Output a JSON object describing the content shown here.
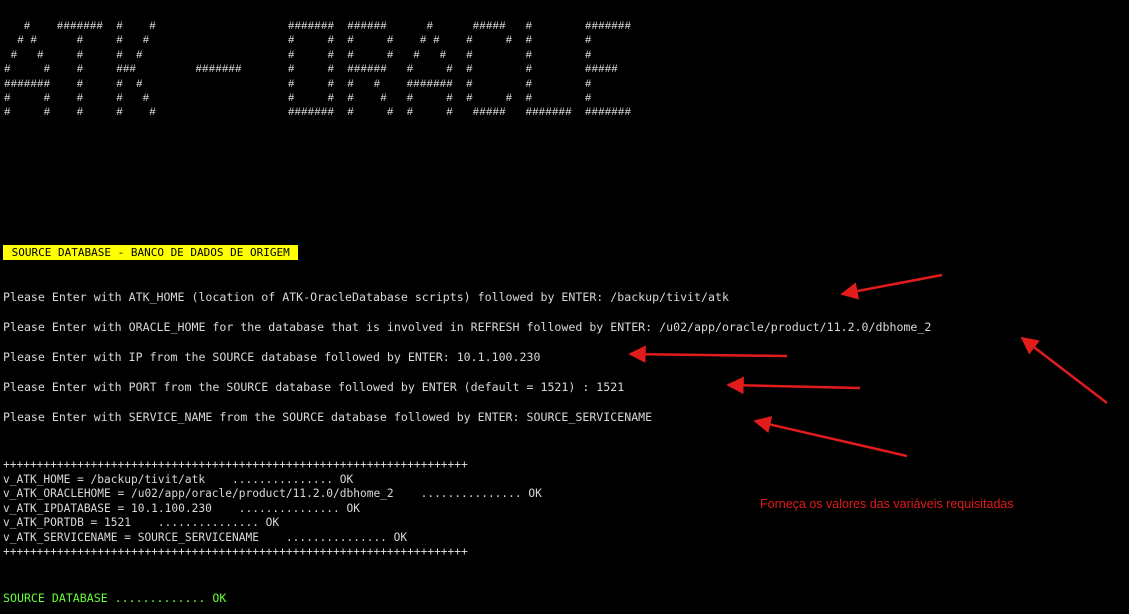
{
  "banner": {
    "lines": [
      "   #    #######  #    #                    #######  ######      #      #####   #        #######",
      "  # #      #     #   #                     #     #  #     #    # #    #     #  #        #",
      " #   #     #     #  #                      #     #  #     #   #   #   #        #        #",
      "#     #    #     ###         #######       #     #  ######   #     #  #        #        #####",
      "#######    #     #  #                      #     #  #   #    #######  #        #        #",
      "#     #    #     #   #                     #     #  #    #   #     #  #     #  #        #",
      "#     #    #     #    #                    #######  #     #  #     #   #####   #######  #######"
    ]
  },
  "section_header": " SOURCE DATABASE - BANCO DE DADOS DE ORIGEM ",
  "prompts": [
    "Please Enter with ATK_HOME (location of ATK-OracleDatabase scripts) followed by ENTER: /backup/tivit/atk",
    "Please Enter with ORACLE_HOME for the database that is involved in REFRESH followed by ENTER: /u02/app/oracle/product/11.2.0/dbhome_2",
    "Please Enter with IP from the SOURCE database followed by ENTER: 10.1.100.230",
    "Please Enter with PORT from the SOURCE database followed by ENTER (default = 1521) : 1521",
    "Please Enter with SERVICE_NAME from the SOURCE database followed by ENTER: SOURCE_SERVICENAME"
  ],
  "summary": {
    "separator": "+++++++++++++++++++++++++++++++++++++++++++++++++++++++++++++++++++++",
    "lines": [
      "v_ATK_HOME = /backup/tivit/atk    ............... OK",
      "v_ATK_ORACLEHOME = /u02/app/oracle/product/11.2.0/dbhome_2    ............... OK",
      "v_ATK_IPDATABASE = 10.1.100.230    ............... OK",
      "v_ATK_PORTDB = 1521    ............... OK",
      "v_ATK_SERVICENAME = SOURCE_SERVICENAME    ............... OK"
    ]
  },
  "status_line": "SOURCE DATABASE ............. OK",
  "annotation": "Forneça os valores das variáveis requisitadas",
  "colors": {
    "background": "#000000",
    "text": "#d8d8d8",
    "highlight_bg": "#ffff00",
    "ok_green": "#66ff33",
    "annotation_red": "#e21b1b"
  }
}
